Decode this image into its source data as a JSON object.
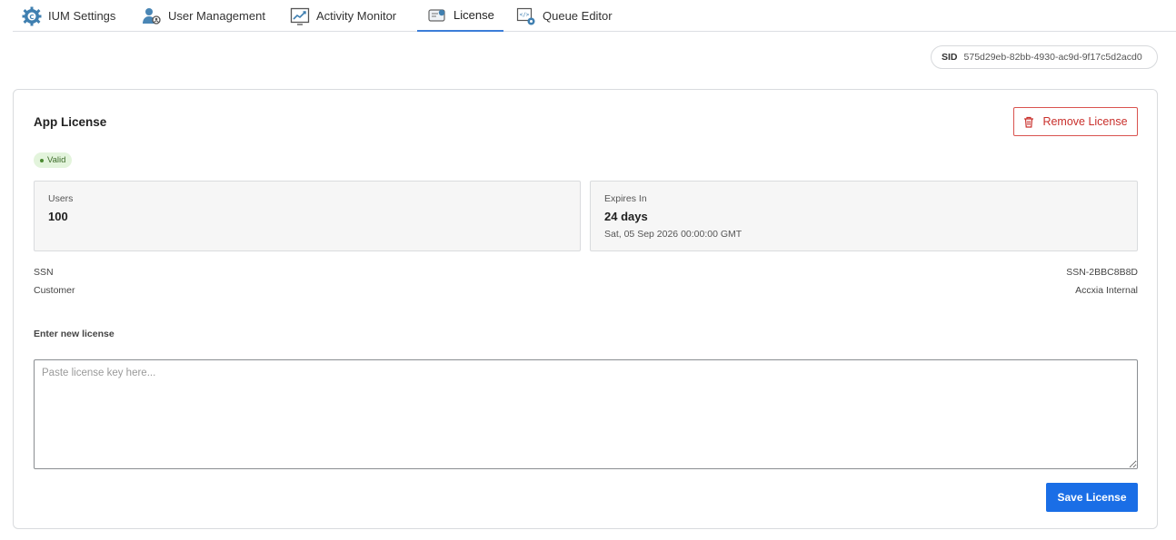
{
  "tabs": [
    {
      "label": "IUM Settings",
      "icon": "gear-icon"
    },
    {
      "label": "User Management",
      "icon": "users-icon"
    },
    {
      "label": "Activity Monitor",
      "icon": "chart-icon"
    },
    {
      "label": "License",
      "icon": "license-icon",
      "active": true
    },
    {
      "label": "Queue Editor",
      "icon": "queue-editor-icon"
    }
  ],
  "sid": {
    "key": "SID",
    "value": "575d29eb-82bb-4930-ac9d-9f17c5d2acd0"
  },
  "card": {
    "title": "App License",
    "remove_label": "Remove License",
    "status": "Valid",
    "users": {
      "label": "Users",
      "value": "100"
    },
    "expires": {
      "label": "Expires In",
      "value": "24 days",
      "date": "Sat, 05 Sep 2026 00:00:00 GMT"
    },
    "ssn": {
      "label": "SSN",
      "value": "SSN-2BBC8B8D"
    },
    "customer": {
      "label": "Customer",
      "value": "Accxia Internal"
    },
    "new_license_label": "Enter new license",
    "new_license_placeholder": "Paste license key here...",
    "new_license_value": "",
    "save_label": "Save License"
  },
  "colors": {
    "accent": "#1a6ee6",
    "danger": "#c9302c",
    "valid_bg": "#e3f4dc",
    "tab_active": "#3b7dd8"
  }
}
